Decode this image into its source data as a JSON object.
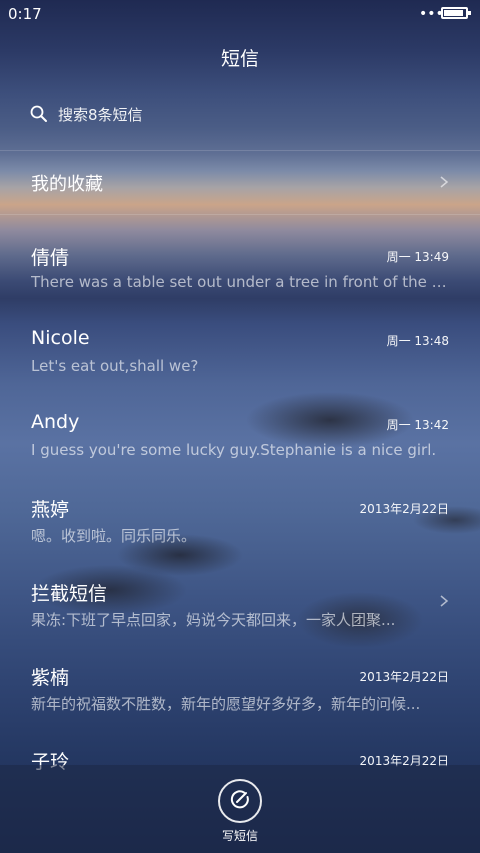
{
  "status": {
    "time": "0:17",
    "dots": "•••",
    "battery_level": 0.9
  },
  "header": {
    "title": "短信"
  },
  "search": {
    "placeholder": "搜索8条短信",
    "icon": "search-icon"
  },
  "favorites": {
    "label": "我的收藏",
    "icon": "chevron-right-icon"
  },
  "threads": [
    {
      "name": "倩倩",
      "time": "周一 13:49",
      "preview": "There was a table set out under a tree in front of the ho..."
    },
    {
      "name": "Nicole",
      "time": "周一 13:48",
      "preview": "Let's eat out,shall we?"
    },
    {
      "name": "Andy",
      "time": "周一 13:42",
      "preview": "I guess you're some lucky guy.Stephanie is a nice girl."
    },
    {
      "name": "燕婷",
      "time": "2013年2月22日",
      "preview": "嗯。收到啦。同乐同乐。"
    },
    {
      "name": "拦截短信",
      "time": "",
      "preview": "果冻:下班了早点回家，妈说今天都回来，一家人团聚..."
    },
    {
      "name": "紫楠",
      "time": "2013年2月22日",
      "preview": "新年的祝福数不胜数，新年的愿望好多好多，新年的问候..."
    },
    {
      "name": "子玲",
      "time": "2013年2月22日",
      "preview": ""
    }
  ],
  "compose": {
    "label": "写短信",
    "icon": "compose-icon"
  }
}
